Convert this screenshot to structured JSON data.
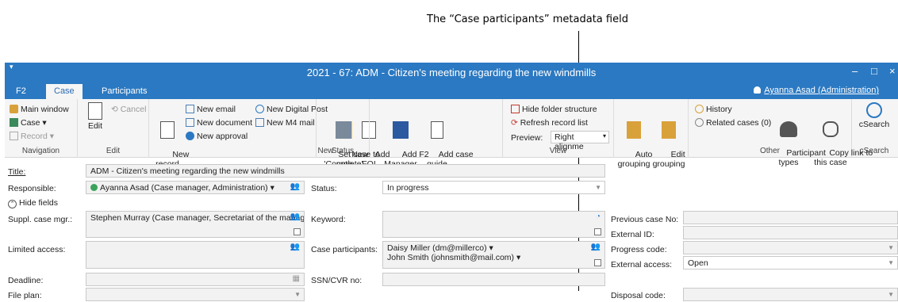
{
  "annotation": {
    "text": "The “Case participants” metadata field"
  },
  "window": {
    "title": "2021 - 67: ADM - Citizen's meeting regarding the new windmills",
    "minimize": "–",
    "maximize": "□",
    "close": "×",
    "quick_access": "▾"
  },
  "tabs": [
    "F2",
    "Case",
    "Participants"
  ],
  "user": {
    "name": "Ayanna Asad (Administration)"
  },
  "ribbon": {
    "navigation": {
      "label": "Navigation",
      "items": [
        "Main window",
        "Case",
        "Record"
      ]
    },
    "edit": {
      "label": "Edit",
      "edit": "Edit",
      "cancel": "Cancel"
    },
    "new": {
      "label": "New",
      "record": "New\nrecord",
      "new_email": "New email",
      "new_document": "New document",
      "new_approval": "New approval",
      "new_digital_post": "New Digital Post",
      "new_m4_mail": "New M4 mail",
      "new_note": "New\nnote",
      "add_foi": "Add\nFOI",
      "add_f2_manager": "Add F2\nManager",
      "add_case_guide": "Add case\nguide"
    },
    "status": {
      "label": "Status",
      "set_complete": "Set case to\n'Complete'"
    },
    "view": {
      "label": "View",
      "hide_folder": "Hide folder structure",
      "refresh": "Refresh record list",
      "preview_label": "Preview:",
      "preview_value": "Right alignme",
      "auto_grouping": "Auto\ngrouping",
      "edit_grouping": "Edit\ngrouping"
    },
    "other": {
      "label": "Other",
      "history": "History",
      "related": "Related cases (0)",
      "participant_types": "Participant\ntypes",
      "copy_link": "Copy link to\nthis case"
    },
    "csearch": {
      "label": "cSearch",
      "csearch": "cSearch"
    }
  },
  "form": {
    "title_label": "Title:",
    "title_value": "ADM - Citizen's meeting regarding the new windmills",
    "responsible_label": "Responsible:",
    "responsible_value": "Ayanna Asad (Case manager, Administration)",
    "status_label": "Status:",
    "status_value": "In progress",
    "hide_fields": "Hide fields",
    "suppl_label": "Suppl. case mgr.:",
    "suppl_value": "Stephen Murray (Case manager, Secretariat of the manag",
    "keyword_label": "Keyword:",
    "prev_case_label": "Previous case No:",
    "external_id_label": "External ID:",
    "limited_label": "Limited access:",
    "participants_label": "Case participants:",
    "participants": [
      "Daisy Miller (dm@millerco)",
      "John Smith (johnsmith@mail.com)"
    ],
    "progress_label": "Progress code:",
    "external_access_label": "External access:",
    "external_access_value": "Open",
    "deadline_label": "Deadline:",
    "ssn_label": "SSN/CVR no:",
    "file_plan_label": "File plan:",
    "disposal_label": "Disposal code:"
  },
  "colors": {
    "titlebar": "#2b79c2",
    "accent": "#2b6cb3",
    "status_green": "#3aa35c"
  }
}
